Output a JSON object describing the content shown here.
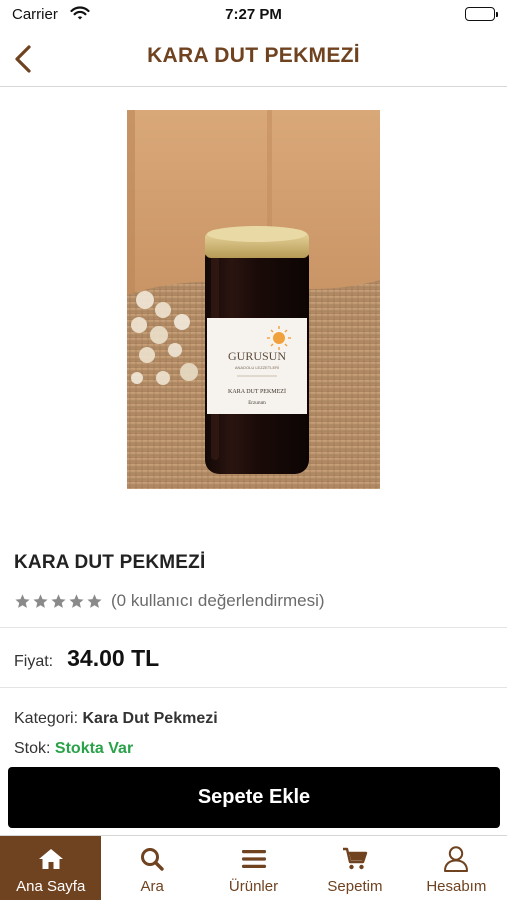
{
  "status_bar": {
    "carrier": "Carrier",
    "time": "7:27 PM"
  },
  "nav": {
    "title": "KARA DUT PEKMEZİ",
    "back_icon": "chevron-left-icon"
  },
  "product": {
    "name": "KARA DUT PEKMEZİ",
    "rating_stars": 5,
    "rating_text": "(0 kullanıcı değerlendirmesi)",
    "price_label": "Fiyat:",
    "price": "34.00 TL",
    "category_label": "Kategori:",
    "category": "Kara Dut Pekmezi",
    "stock_label": "Stok:",
    "stock": "Stokta Var",
    "image": {
      "brand": "GURUSUN",
      "brand_sub": "ANADOLU LEZZETLERİ",
      "label_title": "KARA DUT PEKMEZİ",
      "label_sub": "Erzurum"
    }
  },
  "actions": {
    "add_to_cart": "Sepete Ekle"
  },
  "tab_bar": {
    "items": [
      {
        "label": "Ana Sayfa",
        "icon": "home-icon",
        "active": true
      },
      {
        "label": "Ara",
        "icon": "search-icon",
        "active": false
      },
      {
        "label": "Ürünler",
        "icon": "menu-icon",
        "active": false
      },
      {
        "label": "Sepetim",
        "icon": "cart-icon",
        "active": false
      },
      {
        "label": "Hesabım",
        "icon": "user-icon",
        "active": false
      }
    ]
  },
  "colors": {
    "brand": "#6f4220",
    "stock_green": "#2aa24a",
    "button_bg": "#000000",
    "star_gray": "#8a8a8a"
  }
}
